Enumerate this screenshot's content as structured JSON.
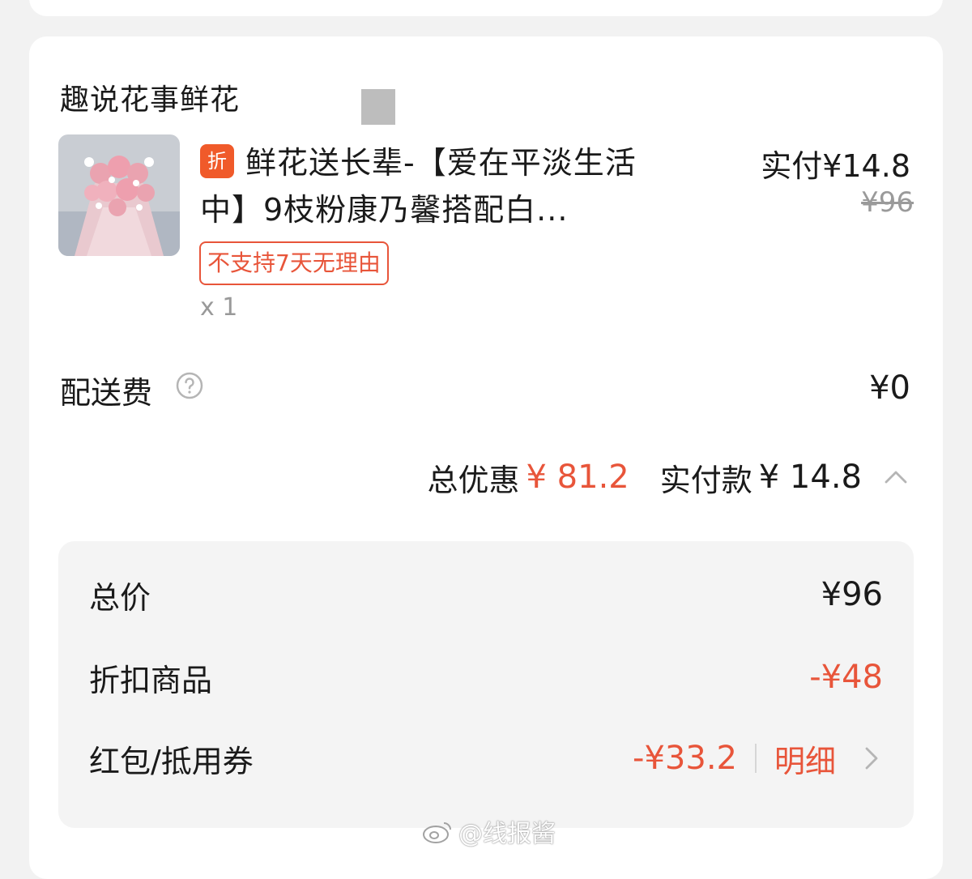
{
  "shop": {
    "name": "趣说花事鲜花"
  },
  "product": {
    "badge": "折",
    "title": "鲜花送长辈-【爱在平淡生活中】9枝粉康乃馨搭配白...",
    "paid_price": "实付¥14.8",
    "original_price": "¥96",
    "return_policy": "不支持7天无理由",
    "quantity": "x 1"
  },
  "delivery": {
    "label": "配送费",
    "value": "¥0",
    "icon": "help-circle-icon"
  },
  "summary": {
    "discount_label": "总优惠",
    "discount_value": "¥ 81.2",
    "paid_label": "实付款",
    "paid_value": "¥ 14.8",
    "icon": "chevron-up-icon"
  },
  "breakdown": {
    "rows": [
      {
        "label": "总价",
        "value": "¥96"
      },
      {
        "label": "折扣商品",
        "value": "-¥48"
      },
      {
        "label": "红包/抵用券",
        "value": "-¥33.2",
        "link": "明细"
      }
    ]
  },
  "watermark": {
    "text": "@线报酱",
    "icon": "weibo-icon"
  },
  "colors": {
    "accent": "#e8553a",
    "badge": "#f05a2a",
    "panel": "#f4f4f4"
  }
}
